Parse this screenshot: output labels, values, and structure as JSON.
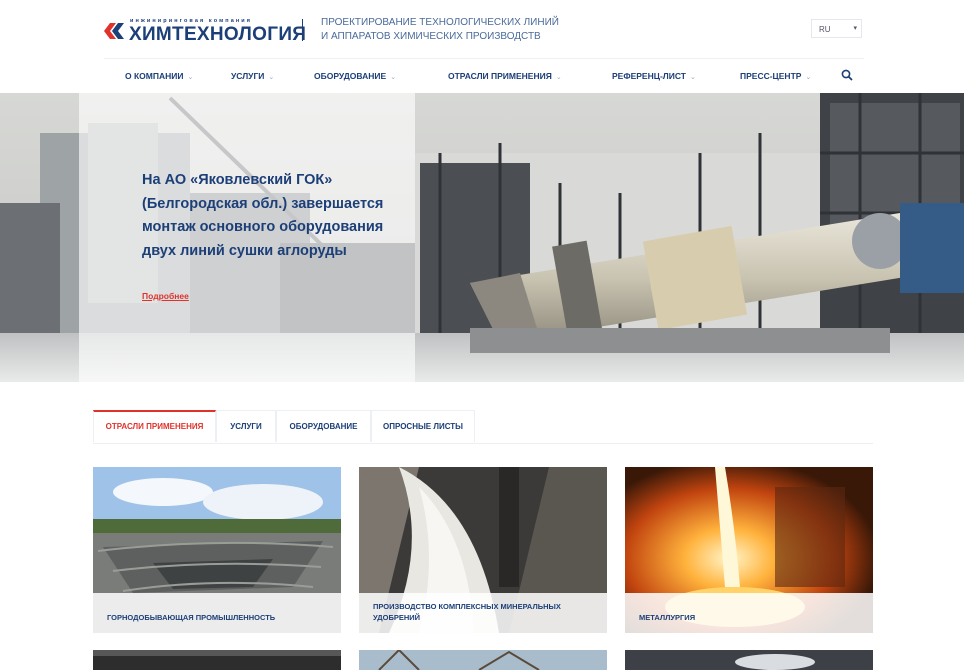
{
  "logo": {
    "small_text": "инжиниринговая компания",
    "main_text": "ХИМТЕХНОЛОГИЯ"
  },
  "tagline": {
    "line1": "ПРОЕКТИРОВАНИЕ ТЕХНОЛОГИЧЕСКИХ ЛИНИЙ",
    "line2": "И АППАРАТОВ ХИМИЧЕСКИХ ПРОИЗВОДСТВ"
  },
  "language": {
    "selected": "RU"
  },
  "nav": {
    "items": [
      "О КОМПАНИИ",
      "УСЛУГИ",
      "ОБОРУДОВАНИЕ",
      "ОТРАСЛИ ПРИМЕНЕНИЯ",
      "РЕФЕРЕНЦ-ЛИСТ",
      "ПРЕСС-ЦЕНТР"
    ]
  },
  "hero": {
    "title": "На АО «Яковлевский ГОК» (Белгородская обл.) завершается монтаж основного оборудования двух линий сушки аглоруды",
    "link": "Подробнее"
  },
  "tabs": {
    "items": [
      "ОТРАСЛИ ПРИМЕНЕНИЯ",
      "УСЛУГИ",
      "ОБОРУДОВАНИЕ",
      "ОПРОСНЫЕ ЛИСТЫ"
    ],
    "active_index": 0
  },
  "cards": [
    {
      "label": "ГОРНОДОБЫВАЮЩАЯ ПРОМЫШЛЕННОСТЬ"
    },
    {
      "label": "ПРОИЗВОДСТВО КОМПЛЕКСНЫХ МИНЕРАЛЬНЫХ УДОБРЕНИЙ"
    },
    {
      "label": "МЕТАЛЛУРГИЯ"
    }
  ],
  "colors": {
    "brand_blue": "#1c3f78",
    "accent_red": "#e0322b"
  }
}
